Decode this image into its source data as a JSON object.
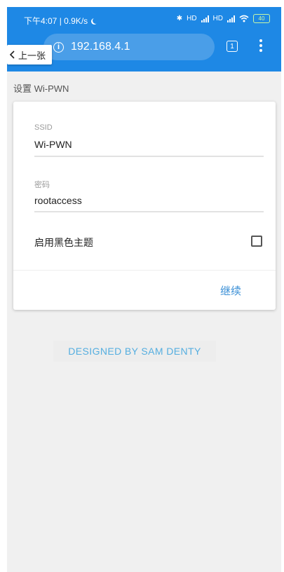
{
  "status_bar": {
    "time_speed": "下午4:07 | 0.9K/s",
    "bluetooth": "✱",
    "signal1": "HD",
    "signal2": "HD",
    "battery": "40"
  },
  "toolbar": {
    "url": "192.168.4.1",
    "tab_count": "1",
    "back_label": "上一张"
  },
  "page": {
    "heading": "设置 Wi-PWN"
  },
  "form": {
    "ssid_label": "SSID",
    "ssid_value": "Wi-PWN",
    "password_label": "密码",
    "password_value": "rootaccess",
    "dark_theme_label": "启用黑色主题",
    "dark_theme_checked": false,
    "continue_label": "继续"
  },
  "footer": {
    "credit": "DESIGNED BY SAM DENTY"
  },
  "colors": {
    "toolbar": "#1e88e5",
    "accent_text": "#3a8fd6",
    "background": "#f0f0f0"
  }
}
